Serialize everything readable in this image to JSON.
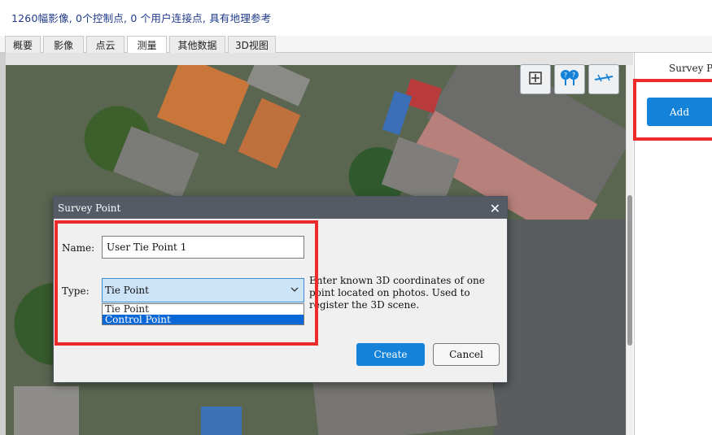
{
  "header": {
    "summary": "1260幅影像, 0个控制点, 0 个用户连接点, 具有地理参考"
  },
  "tabs": [
    {
      "label": "概要"
    },
    {
      "label": "影像"
    },
    {
      "label": "点云"
    },
    {
      "label": "测量",
      "active": true
    },
    {
      "label": "其他数据"
    },
    {
      "label": "3D视图"
    }
  ],
  "map_toolbar": {
    "icons": [
      "grid-add-icon",
      "survey-points-icon",
      "tie-line-icon"
    ]
  },
  "right_panel": {
    "title": "Survey P",
    "add_label": "Add"
  },
  "dialog": {
    "title": "Survey Point",
    "name_label": "Name:",
    "name_value": "User Tie Point 1",
    "type_label": "Type:",
    "type_selected": "Tie Point",
    "type_options": [
      "Tie Point",
      "Control Point"
    ],
    "highlighted_option": "Control Point",
    "help_text": "Enter known 3D coordinates of one point located on photos. Used to register the 3D scene.",
    "create_label": "Create",
    "cancel_label": "Cancel"
  },
  "colors": {
    "accent": "#1382d8",
    "highlight_box": "#ee2b2b",
    "dialog_titlebar": "#545b64"
  }
}
